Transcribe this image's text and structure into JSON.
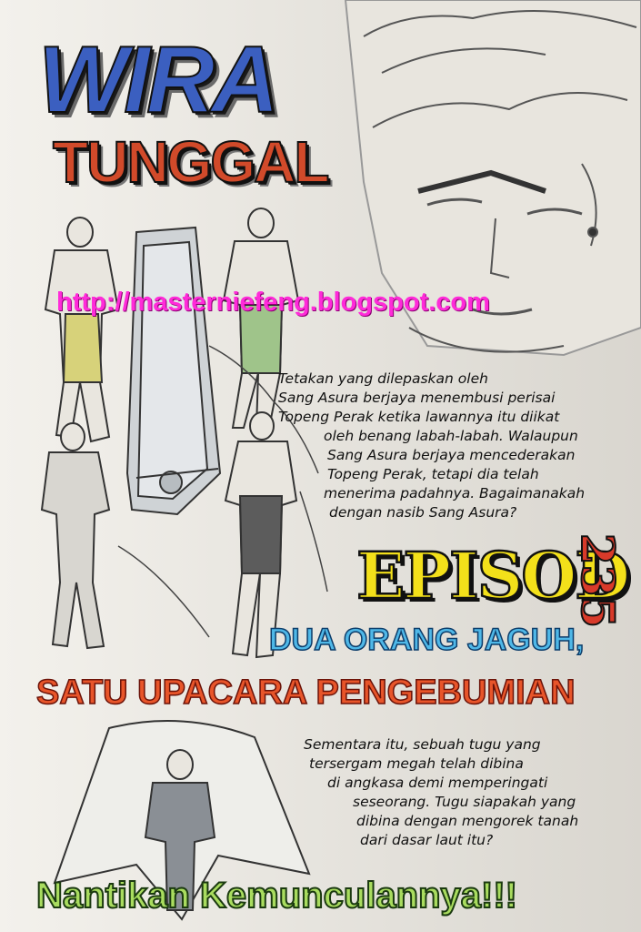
{
  "logo": {
    "line1": "WIRA",
    "line2": "TUNGGAL"
  },
  "watermark_url": "http://masterniefeng.blogspot.com",
  "synopsis_lines": [
    "Tetakan yang dilepaskan oleh",
    "Sang Asura berjaya menembusi perisai",
    "Topeng Perak ketika lawannya itu diikat",
    "oleh benang labah-labah. Walaupun",
    "Sang Asura berjaya mencederakan",
    "Topeng Perak, tetapi dia telah",
    "menerima padahnya. Bagaimanakah",
    "dengan nasib Sang Asura?"
  ],
  "episode": {
    "label": "EPISOD",
    "number": "235"
  },
  "episode_title": {
    "line1": "DUA ORANG JAGUH,",
    "line2": "SATU UPACARA PENGEBUMIAN"
  },
  "next_lines": [
    "Sementara itu, sebuah tugu yang",
    "tersergam megah telah dibina",
    "di angkasa demi memperingati",
    "seseorang. Tugu siapakah yang",
    "dibina dengan mengorek tanah",
    "dari dasar laut itu?"
  ],
  "footer": "Nantikan Kemunculannya!!!",
  "colors": {
    "url": "#ff2bd9",
    "episode_label": "#f3e01a",
    "episode_number": "#d83a2a",
    "title1": "#4fb8e8",
    "title2": "#e8552a",
    "footer": "#a9dc5f"
  }
}
